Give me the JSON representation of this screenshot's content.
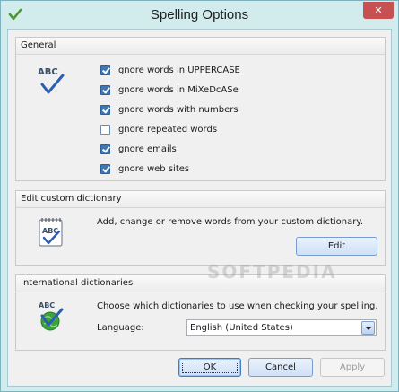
{
  "window": {
    "title": "Spelling Options",
    "close_glyph": "✕"
  },
  "general": {
    "header": "General",
    "icon": "abc-spellcheck-icon",
    "options": [
      {
        "label": "Ignore words in UPPERCASE",
        "checked": true
      },
      {
        "label": "Ignore words in MiXeDcASe",
        "checked": true
      },
      {
        "label": "Ignore words with numbers",
        "checked": true
      },
      {
        "label": "Ignore repeated words",
        "checked": false
      },
      {
        "label": "Ignore emails",
        "checked": true
      },
      {
        "label": "Ignore web sites",
        "checked": true
      }
    ]
  },
  "custom_dictionary": {
    "header": "Edit custom dictionary",
    "icon": "notebook-abc-icon",
    "description": "Add, change or remove words from your custom dictionary.",
    "edit_label": "Edit"
  },
  "international": {
    "header": "International dictionaries",
    "icon": "globe-abc-icon",
    "description": "Choose which dictionaries to use when checking your spelling.",
    "language_label": "Language:",
    "language_value": "English (United States)"
  },
  "footer": {
    "ok_label": "OK",
    "cancel_label": "Cancel",
    "apply_label": "Apply"
  },
  "watermark": "SOFTPEDIA",
  "colors": {
    "window_frame": "#d2ecee",
    "close_button": "#c75050",
    "checkbox_checked": "#3f77b2",
    "icon_blue": "#2a5fb0",
    "icon_green": "#3aa33a"
  }
}
